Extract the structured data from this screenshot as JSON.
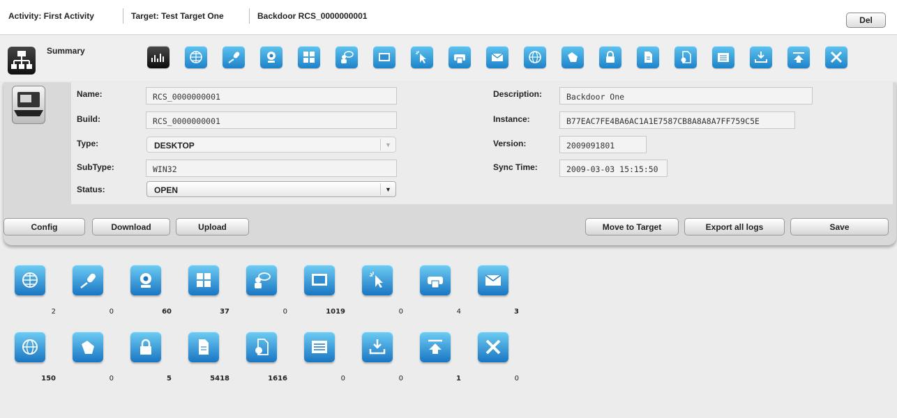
{
  "header": {
    "activity": "Activity: First Activity",
    "target": "Target: Test Target One",
    "backdoor": "Backdoor RCS_0000000001",
    "del_label": "Del"
  },
  "toolbar": {
    "summary_label": "Summary",
    "icons": [
      "chart-icon",
      "globe-phone-icon",
      "microphone-icon",
      "webcam-icon",
      "keylog-icon",
      "chat-icon",
      "screenshot-icon",
      "mouse-icon",
      "printer-icon",
      "mail-icon",
      "url-icon",
      "clipboard-icon",
      "password-icon",
      "file-icon",
      "file-open-icon",
      "application-icon",
      "download-icon",
      "upload-icon",
      "tools-icon"
    ]
  },
  "backdoor": {
    "labels": {
      "name": "Name:",
      "build": "Build:",
      "type": "Type:",
      "subtype": "SubType:",
      "status": "Status:",
      "description": "Description:",
      "instance": "Instance:",
      "version": "Version:",
      "sync_time": "Sync Time:"
    },
    "name": "RCS_0000000001",
    "build": "RCS_0000000001",
    "type": "DESKTOP",
    "subtype": "WIN32",
    "status": "OPEN",
    "description": "Backdoor One",
    "instance": "B77EAC7FE4BA6AC1A1E7587CB8A8A8A7FF759C5E",
    "version": "2009091801",
    "sync_time": "2009-03-03 15:15:50",
    "device_icon": "laptop-windows-icon"
  },
  "actions": {
    "config": "Config",
    "download": "Download",
    "upload": "Upload",
    "move_to_target": "Move to Target",
    "export_all_logs": "Export all logs",
    "save": "Save"
  },
  "evidence": [
    {
      "icon": "globe-phone-icon",
      "count": "2",
      "bold": false
    },
    {
      "icon": "microphone-icon",
      "count": "0",
      "bold": false
    },
    {
      "icon": "webcam-icon",
      "count": "60",
      "bold": true
    },
    {
      "icon": "keylog-icon",
      "count": "37",
      "bold": true
    },
    {
      "icon": "chat-icon",
      "count": "0",
      "bold": false
    },
    {
      "icon": "screenshot-icon",
      "count": "1019",
      "bold": true
    },
    {
      "icon": "mouse-icon",
      "count": "0",
      "bold": false
    },
    {
      "icon": "printer-icon",
      "count": "4",
      "bold": false
    },
    {
      "icon": "mail-icon",
      "count": "3",
      "bold": true
    },
    {
      "icon": "url-icon",
      "count": "150",
      "bold": true
    },
    {
      "icon": "clipboard-icon",
      "count": "0",
      "bold": false
    },
    {
      "icon": "password-icon",
      "count": "5",
      "bold": true
    },
    {
      "icon": "file-icon",
      "count": "5418",
      "bold": true
    },
    {
      "icon": "file-open-icon",
      "count": "1616",
      "bold": true
    },
    {
      "icon": "application-icon",
      "count": "0",
      "bold": false
    },
    {
      "icon": "download-icon",
      "count": "0",
      "bold": false
    },
    {
      "icon": "upload-icon",
      "count": "1",
      "bold": true
    },
    {
      "icon": "tools-icon",
      "count": "0",
      "bold": false
    }
  ],
  "colors": {
    "icon_blue_top": "#6fcdf4",
    "icon_blue_bottom": "#1976c2",
    "panel": "#d9d9d9"
  }
}
